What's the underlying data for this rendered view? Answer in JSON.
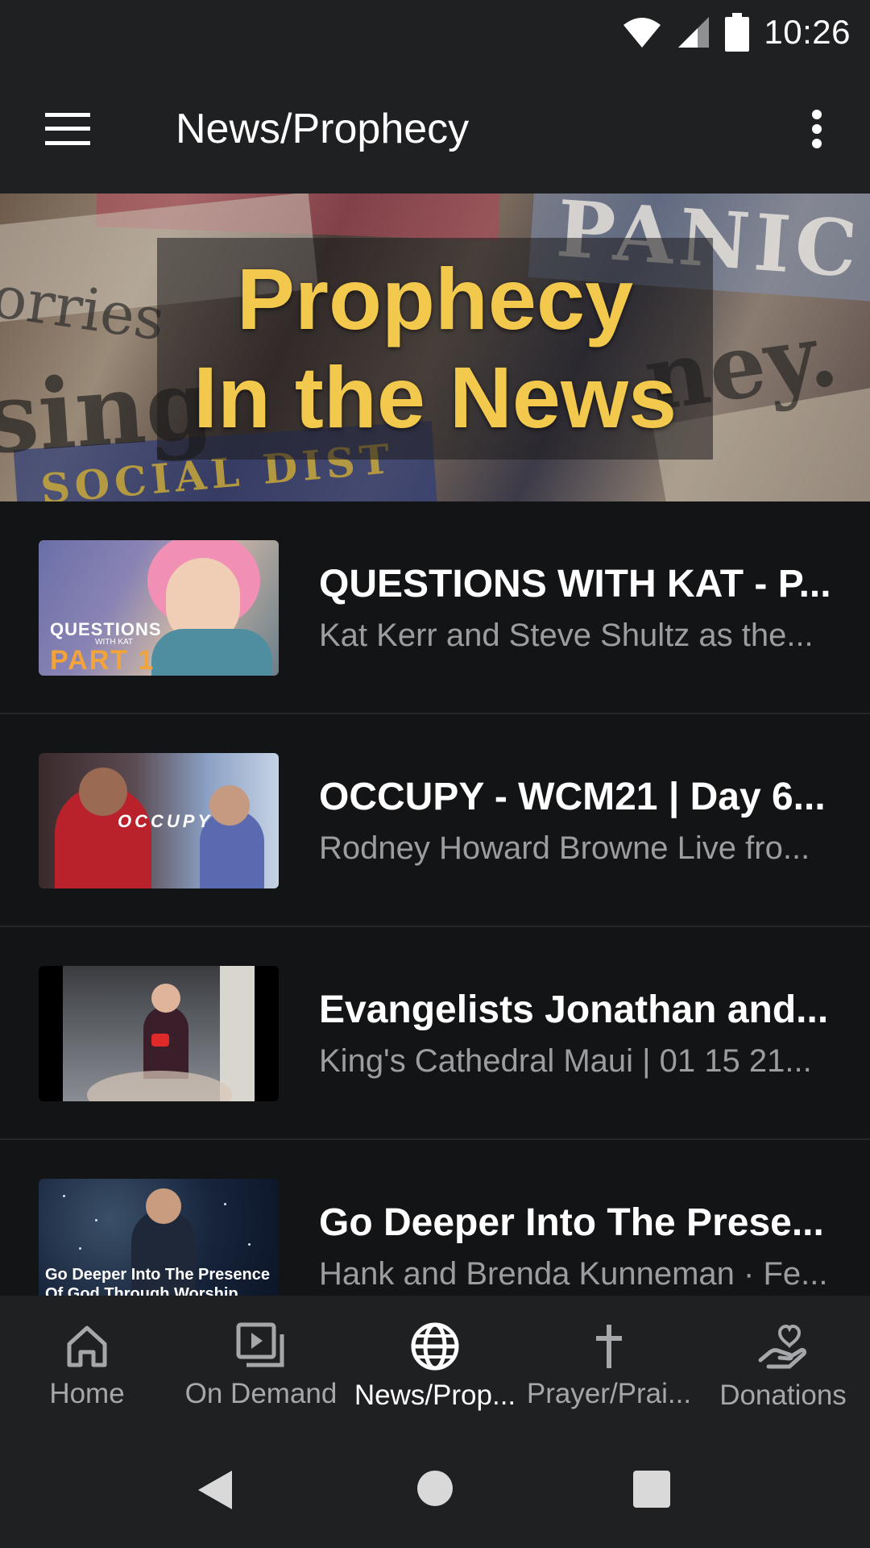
{
  "status_bar": {
    "time": "10:26",
    "icons": [
      "wifi-icon",
      "cell-signal-icon",
      "battery-icon"
    ]
  },
  "app_bar": {
    "title": "News/Prophecy",
    "menu_icon": "hamburger-menu-icon",
    "more_icon": "more-vert-icon"
  },
  "hero": {
    "title_line1": "Prophecy",
    "title_line2": "In the News",
    "bg_words": [
      "PANIC",
      "orries",
      "sing",
      "ney.",
      "SOCIAL DIST"
    ]
  },
  "videos": [
    {
      "title": "QUESTIONS WITH KAT - P...",
      "subtitle": "Kat Kerr and Steve Shultz as the...",
      "thumb": {
        "line1": "QUESTIONS",
        "line2": "WITH KAT",
        "line3": "PART 1"
      }
    },
    {
      "title": "OCCUPY - WCM21 | Day 6...",
      "subtitle": "Rodney Howard Browne Live fro...",
      "thumb": {
        "line1": "OCCUPY"
      }
    },
    {
      "title": "Evangelists Jonathan and...",
      "subtitle": "King's Cathedral Maui | 01 15 21...",
      "thumb": {}
    },
    {
      "title": "Go Deeper Into The Prese...",
      "subtitle": "Hank and Brenda Kunneman · Fe...",
      "thumb": {
        "line1": "Go Deeper Into The Presence",
        "line2": "Of God Through Worship"
      }
    }
  ],
  "bottom_nav": [
    {
      "label": "Home",
      "icon": "home-icon",
      "active": false
    },
    {
      "label": "On Demand",
      "icon": "video-library-icon",
      "active": false
    },
    {
      "label": "News/Prop...",
      "icon": "globe-icon",
      "active": true
    },
    {
      "label": "Prayer/Prai...",
      "icon": "cross-icon",
      "active": false
    },
    {
      "label": "Donations",
      "icon": "donate-heart-hand-icon",
      "active": false
    }
  ],
  "colors": {
    "accent_gold": "#f2c94c",
    "background": "#131416",
    "bar": "#1f2022",
    "subtitle_gray": "#9c9da0"
  }
}
